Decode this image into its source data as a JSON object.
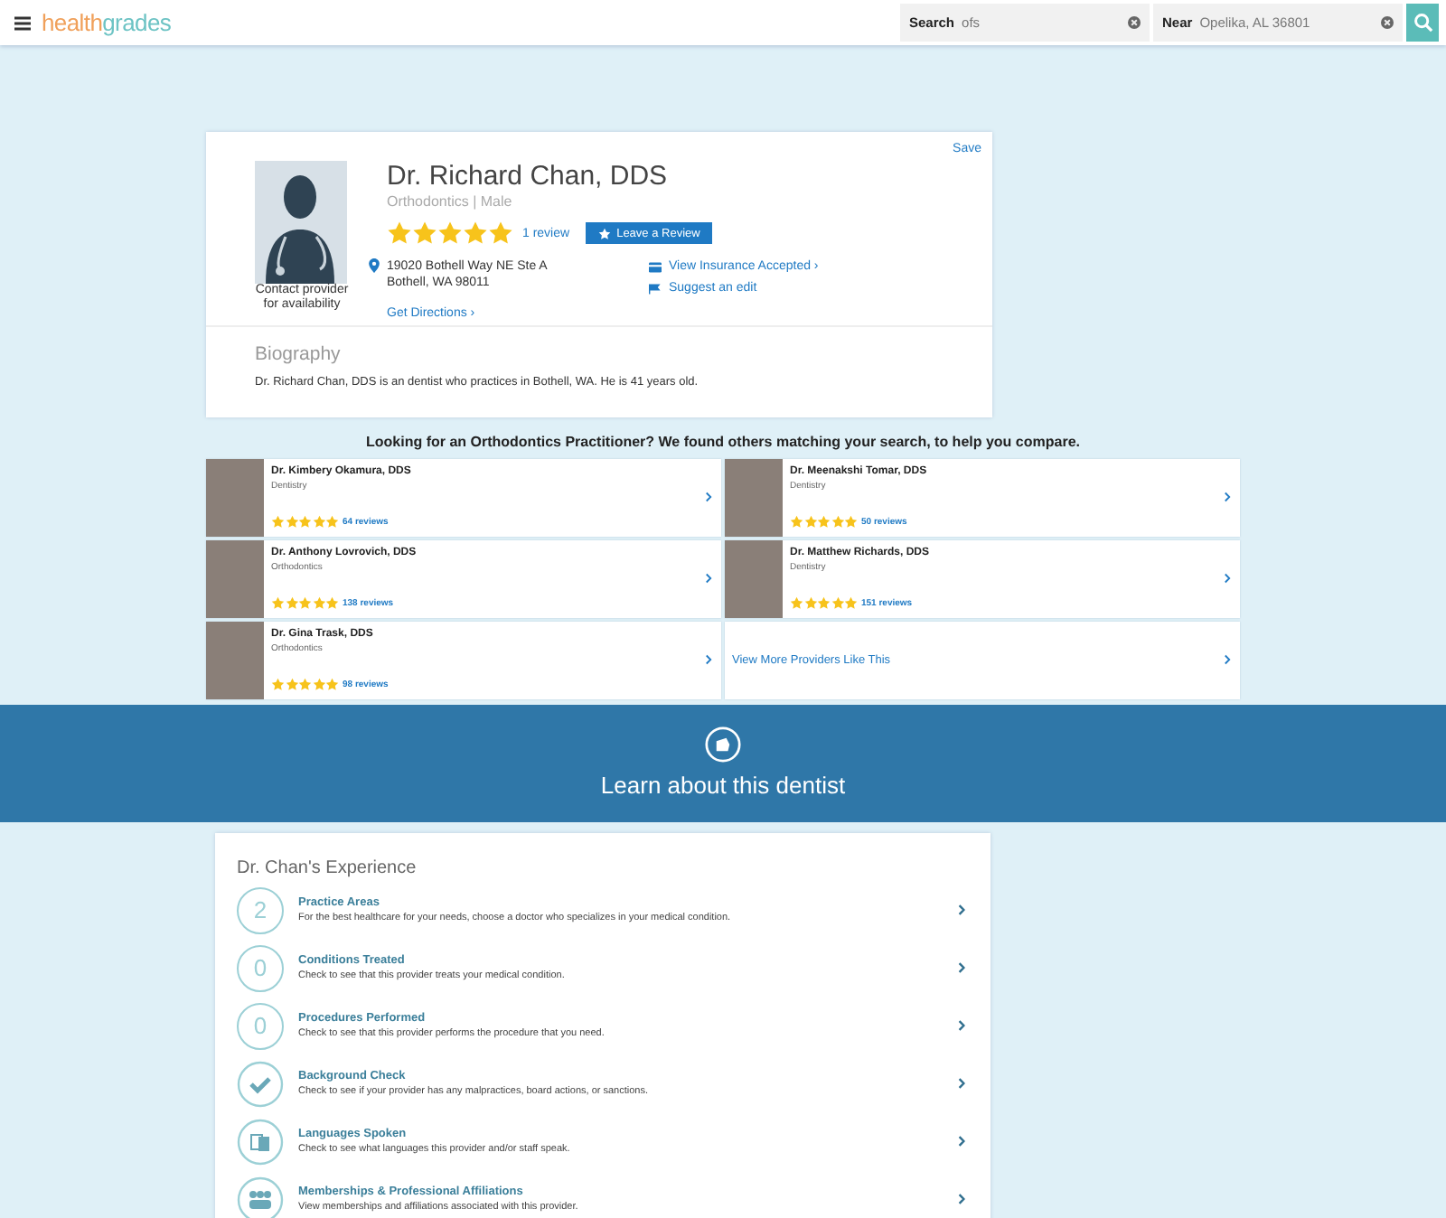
{
  "header": {
    "logo": [
      "health",
      "grades"
    ],
    "search": {
      "label": "Search",
      "value": "ofs"
    },
    "near": {
      "label": "Near",
      "value": "Opelika, AL 36801"
    }
  },
  "profile": {
    "save": "Save",
    "photo_caption": "Contact provider for availability",
    "name": "Dr. Richard Chan, DDS",
    "subtitle": "Orthodontics | Male",
    "stars": 5,
    "reviews": "1 review",
    "review_button": "Leave a Review",
    "address": [
      "19020 Bothell Way NE Ste A",
      "Bothell, WA 98011"
    ],
    "directions": "Get Directions ›",
    "insurance": "View Insurance Accepted ›",
    "suggest": "Suggest an edit",
    "bio_title": "Biography",
    "bio": "Dr. Richard Chan, DDS is an dentist who practices in Bothell, WA. He is 41 years old."
  },
  "compare": {
    "heading": "Looking for an Orthodontics Practitioner? We found others matching your search, to help you compare.",
    "providers": [
      {
        "name": "Dr. Kimbery Okamura, DDS",
        "specialty": "Dentistry",
        "stars": 5,
        "reviews": "64 reviews"
      },
      {
        "name": "Dr. Meenakshi Tomar, DDS",
        "specialty": "Dentistry",
        "stars": 5,
        "reviews": "50 reviews"
      },
      {
        "name": "Dr. Anthony Lovrovich, DDS",
        "specialty": "Orthodontics",
        "stars": 5,
        "reviews": "138 reviews"
      },
      {
        "name": "Dr. Matthew Richards, DDS",
        "specialty": "Dentistry",
        "stars": 5,
        "reviews": "151 reviews"
      },
      {
        "name": "Dr. Gina Trask, DDS",
        "specialty": "Orthodontics",
        "stars": 5,
        "reviews": "98 reviews"
      }
    ],
    "more": "View More Providers Like This"
  },
  "banner": {
    "title": "Learn about this dentist"
  },
  "experience": {
    "title": "Dr. Chan's Experience",
    "items": [
      {
        "kind": "count",
        "count": "2",
        "title": "Practice Areas",
        "text": "For the best healthcare for your needs, choose a doctor who specializes in your medical condition."
      },
      {
        "kind": "count",
        "count": "0",
        "title": "Conditions Treated",
        "text": "Check to see that this provider treats your medical condition."
      },
      {
        "kind": "count",
        "count": "0",
        "title": "Procedures Performed",
        "text": "Check to see that this provider performs the procedure that you need."
      },
      {
        "kind": "check",
        "title": "Background Check",
        "text": "Check to see if your provider has any malpractices, board actions, or sanctions."
      },
      {
        "kind": "languages",
        "title": "Languages Spoken",
        "text": "Check to see what languages this provider and/or staff speak."
      },
      {
        "kind": "memberships",
        "title": "Memberships & Professional Affiliations",
        "text": "View memberships and affiliations associated with this provider."
      }
    ]
  }
}
